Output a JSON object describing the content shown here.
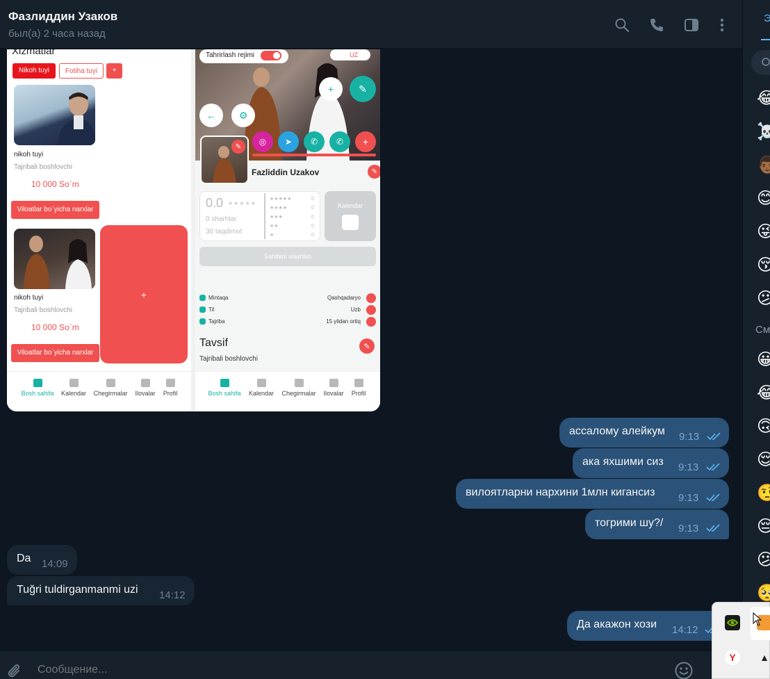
{
  "header": {
    "contact_name": "Фазлиддин Узаков",
    "status": "был(а) 2 часа назад"
  },
  "emoji_panel": {
    "tab_label": "Э",
    "section_label": "См",
    "top_emojis": [
      "😂",
      "☠️",
      "👨🏾",
      "😊",
      "😜",
      "😚",
      "😕"
    ],
    "smileys": [
      "😀",
      "😂",
      "🙃",
      "😌",
      "🤨",
      "😔",
      "😕",
      "🥺"
    ]
  },
  "screenshot": {
    "left_phone": {
      "section_title": "Xizmatlar",
      "chips": [
        "Nikoh tuyi",
        "Fotiha tuyi",
        "+"
      ],
      "cards": [
        {
          "title": "nikoh tuyi",
          "subtitle": "Tajribali boshlovchi",
          "price": "10 000 So`m",
          "button": "Viloatlar bo`yicha narxlar"
        },
        {
          "title": "nikoh tuyi",
          "subtitle": "Tajribali boshlovchi",
          "price": "10 000 So`m",
          "button": "Viloatlar bo`yicha narxlar"
        }
      ],
      "add_label": "+",
      "nav": [
        "Bosh sahifa",
        "Kalendar",
        "Chegirmalar",
        "Ilovalar",
        "Profil"
      ]
    },
    "right_phone": {
      "edit_mode_label": "Tahrirlash rejimi",
      "lang": "UZ",
      "profile_name": "Fazliddin Uzakov",
      "rating_value": "0.0",
      "reviews": "0 sharhlar",
      "bookings": "30 taqdimot",
      "star_counts": [
        "0",
        "0",
        "0",
        "0",
        "0"
      ],
      "calendar_label": "Kalendar",
      "share_label": "Sahifani ulashish",
      "info": [
        {
          "label": "Mintaqa",
          "value": "Qashqadaryo"
        },
        {
          "label": "Til",
          "value": "Uzb"
        },
        {
          "label": "Tajriba",
          "value": "15 yildan ortiq"
        }
      ],
      "description_title": "Tavsif",
      "description_text": "Tajribali boshlovchi",
      "nav": [
        "Bosh sahifa",
        "Kalendar",
        "Chegirmalar",
        "Ilovalar",
        "Profil"
      ]
    }
  },
  "messages": [
    {
      "direction": "out",
      "text": "ассалому алейкум",
      "time": "9:13"
    },
    {
      "direction": "out",
      "text": "ака яхшими сиз",
      "time": "9:13"
    },
    {
      "direction": "out",
      "text": "вилоятларни нархини 1млн кигансиз",
      "time": "9:13"
    },
    {
      "direction": "out",
      "text": "тогрими шу?/",
      "time": "9:13"
    },
    {
      "direction": "in",
      "text": "Da",
      "time": "14:09"
    },
    {
      "direction": "in",
      "text": "Tuğri tuldirganmanmi uzi",
      "time": "14:12"
    },
    {
      "direction": "out",
      "text": "Да акажон хози",
      "time": "14:12"
    }
  ],
  "input": {
    "placeholder": "Сообщение..."
  },
  "colors": {
    "background": "#0e1621",
    "header": "#17212b",
    "outgoing_bubble": "#2b5278",
    "incoming_bubble": "#182533",
    "accent": "#5eb5f7",
    "app_red": "#f0504f",
    "app_teal": "#18b2a5"
  }
}
